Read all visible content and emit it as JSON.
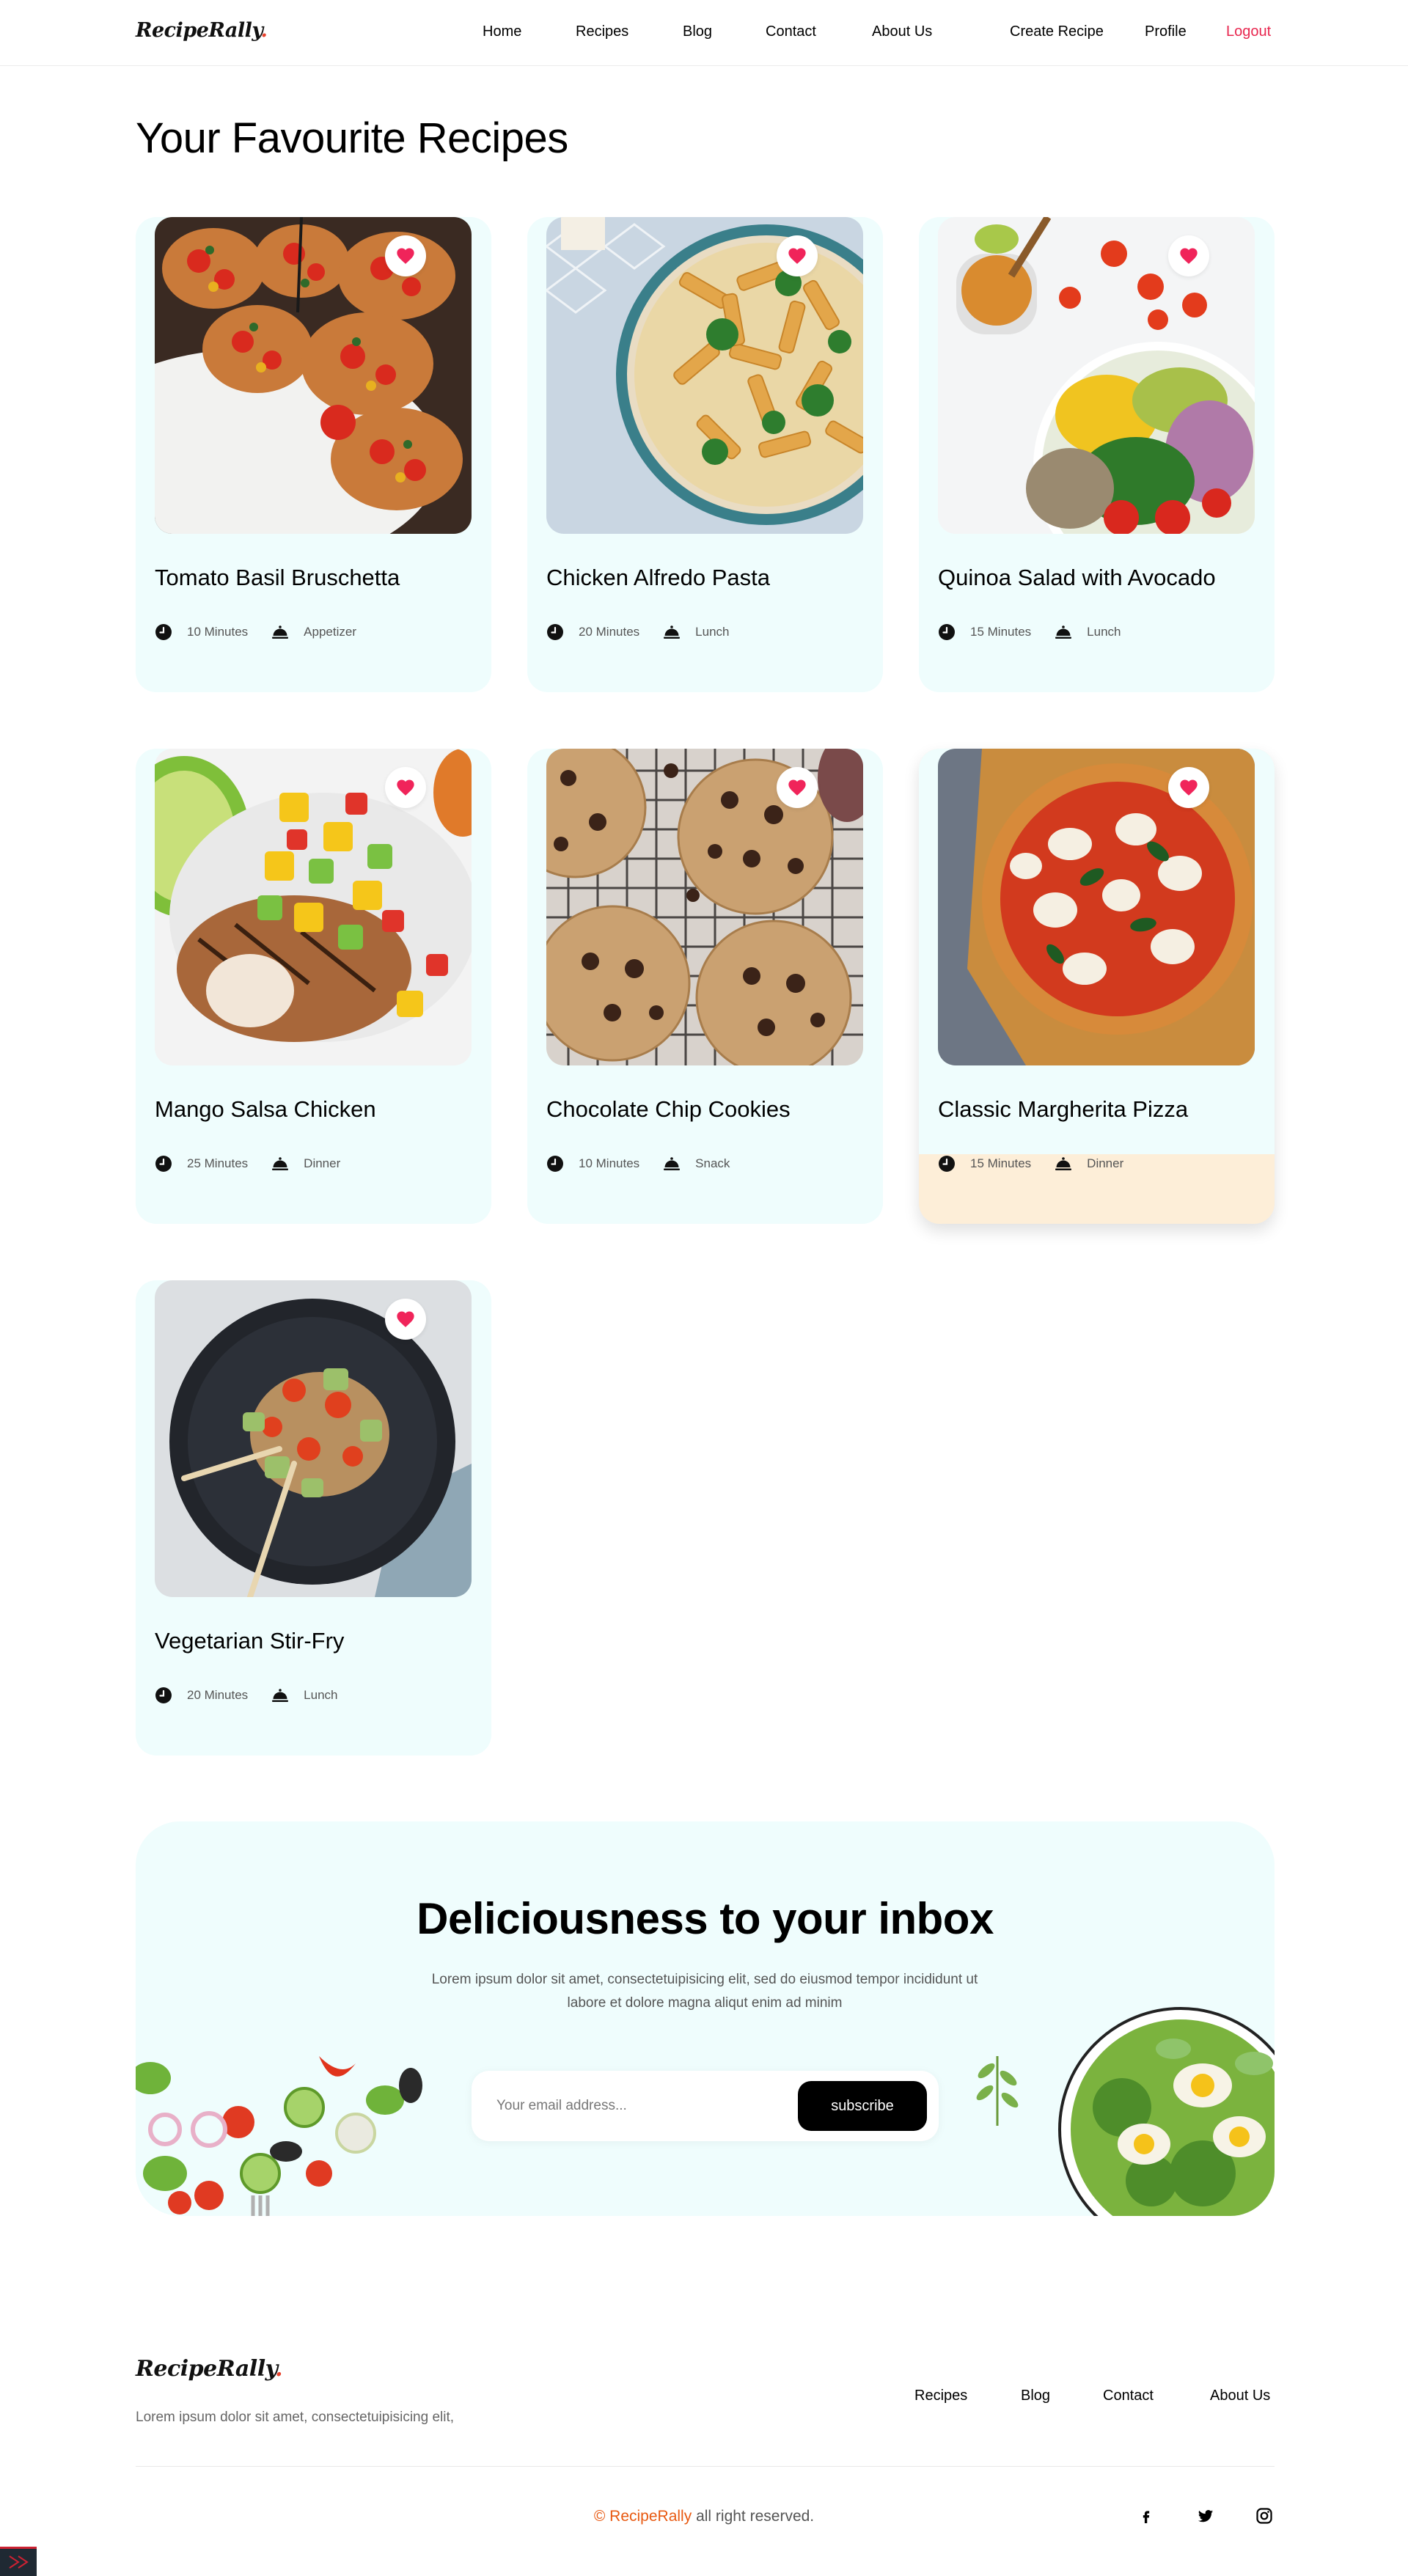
{
  "nav": {
    "logo": "RecipeRally",
    "logo_dot": ".",
    "links": [
      "Home",
      "Recipes",
      "Blog",
      "Contact",
      "About Us"
    ],
    "create_recipe": "Create Recipe",
    "profile": "Profile",
    "logout": "Logout"
  },
  "page_title": "Your Favourite Recipes",
  "recipes": [
    {
      "title": "Tomato Basil Bruschetta",
      "time": "10 Minutes",
      "category": "Appetizer",
      "image": "bruschetta"
    },
    {
      "title": "Chicken Alfredo Pasta",
      "time": "20 Minutes",
      "category": "Lunch",
      "image": "pasta"
    },
    {
      "title": "Quinoa Salad with Avocado",
      "time": "15 Minutes",
      "category": "Lunch",
      "image": "quinoa-salad"
    },
    {
      "title": "Mango Salsa Chicken",
      "time": "25 Minutes",
      "category": "Dinner",
      "image": "mango-chicken"
    },
    {
      "title": "Chocolate Chip Cookies",
      "time": "10 Minutes",
      "category": "Snack",
      "image": "cookies"
    },
    {
      "title": "Classic Margherita Pizza",
      "time": "15 Minutes",
      "category": "Dinner",
      "image": "pizza"
    },
    {
      "title": "Vegetarian Stir-Fry",
      "time": "20 Minutes",
      "category": "Lunch",
      "image": "stir-fry"
    }
  ],
  "icons": {
    "favourite": "heart-icon",
    "time": "clock-icon",
    "category": "cloche-icon"
  },
  "newsletter": {
    "title": "Deliciousness to your inbox",
    "description": "Lorem ipsum dolor sit amet, consectetuipisicing elit, sed do eiusmod tempor incididunt ut labore et dolore magna aliqut enim ad minim",
    "email_placeholder": "Your email address...",
    "subscribe_label": "subscribe"
  },
  "footer": {
    "logo": "RecipeRally",
    "logo_dot": ".",
    "description": "Lorem ipsum dolor sit amet, consectetuipisicing elit,",
    "links": [
      "Recipes",
      "Blog",
      "Contact",
      "About Us"
    ],
    "copyright_symbol": "©",
    "copyright_brand": "RecipeRally",
    "copyright_text": "all right reserved.",
    "social": [
      "facebook-icon",
      "twitter-icon",
      "instagram-icon"
    ]
  },
  "colors": {
    "accent_red": "#e8274f",
    "brand_orange": "#e85a12",
    "card_bg": "#effdfd",
    "card_hover_bg": "#fdeed8"
  }
}
